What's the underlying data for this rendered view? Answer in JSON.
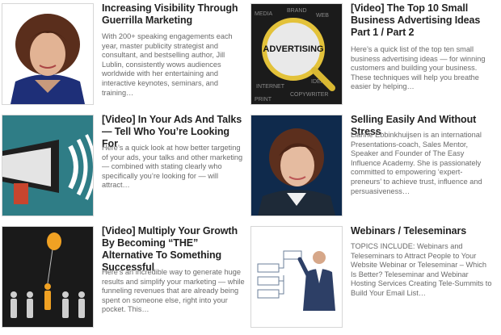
{
  "posts": [
    {
      "title": "Increasing Visibility Through Guerrilla Marketing",
      "excerpt": "With 200+ speaking engagements each year, master publicity strategist and consultant, and bestselling author, Jill Lublin, consistently wows audiences worldwide with her entertaining and interactive keynotes, seminars, and training…",
      "thumb_icon": "woman-portrait-icon"
    },
    {
      "title": "[Video] The Top 10 Small Business Advertising Ideas Part 1 / Part 2",
      "excerpt": "Here’s a quick list of the top ten small business advertising ideas — for winning customers and building your business. These techniques will help you breathe easier by helping…",
      "thumb_icon": "magnifier-advertising-icon",
      "thumb_text": "ADVERTISING"
    },
    {
      "title": "[Video] In Your Ads And Talks — Tell Who You’re Looking For",
      "excerpt": "Here’s a quick look at how better targeting of your ads, your talks and other marketing — combined with stating clearly who specifically you’re looking for — will attract…",
      "thumb_icon": "megaphone-icon"
    },
    {
      "title": "Selling Easily And Without Stress",
      "excerpt": "Lianne Ebbinkhuijsen is an international Presentations-coach, Sales Mentor, Speaker and Founder of The Easy Influence Academy. She is passionately committed to empowering ‘expert-preneurs’ to achieve trust, influence and persuasiveness…",
      "thumb_icon": "woman-portrait-icon"
    },
    {
      "title": "[Video] Multiply Your Growth By Becoming “THE” Alternative To Something Successful",
      "excerpt": "Here’s an incredible way to generate huge results and simplify your marketing — while funneling revenues that are already being spent on someone else, right into your pocket. This…",
      "thumb_icon": "balloon-people-icon"
    },
    {
      "title": "Webinars / Teleseminars",
      "excerpt": "TOPICS INCLUDE: Webinars and Teleseminars to Attract People to Your Website Webinar or Teleseminar – Which Is Better? Teleseminar and Webinar Hosting Services Creating Tele-Summits to Build Your Email List…",
      "thumb_icon": "businessman-diagram-icon"
    }
  ]
}
